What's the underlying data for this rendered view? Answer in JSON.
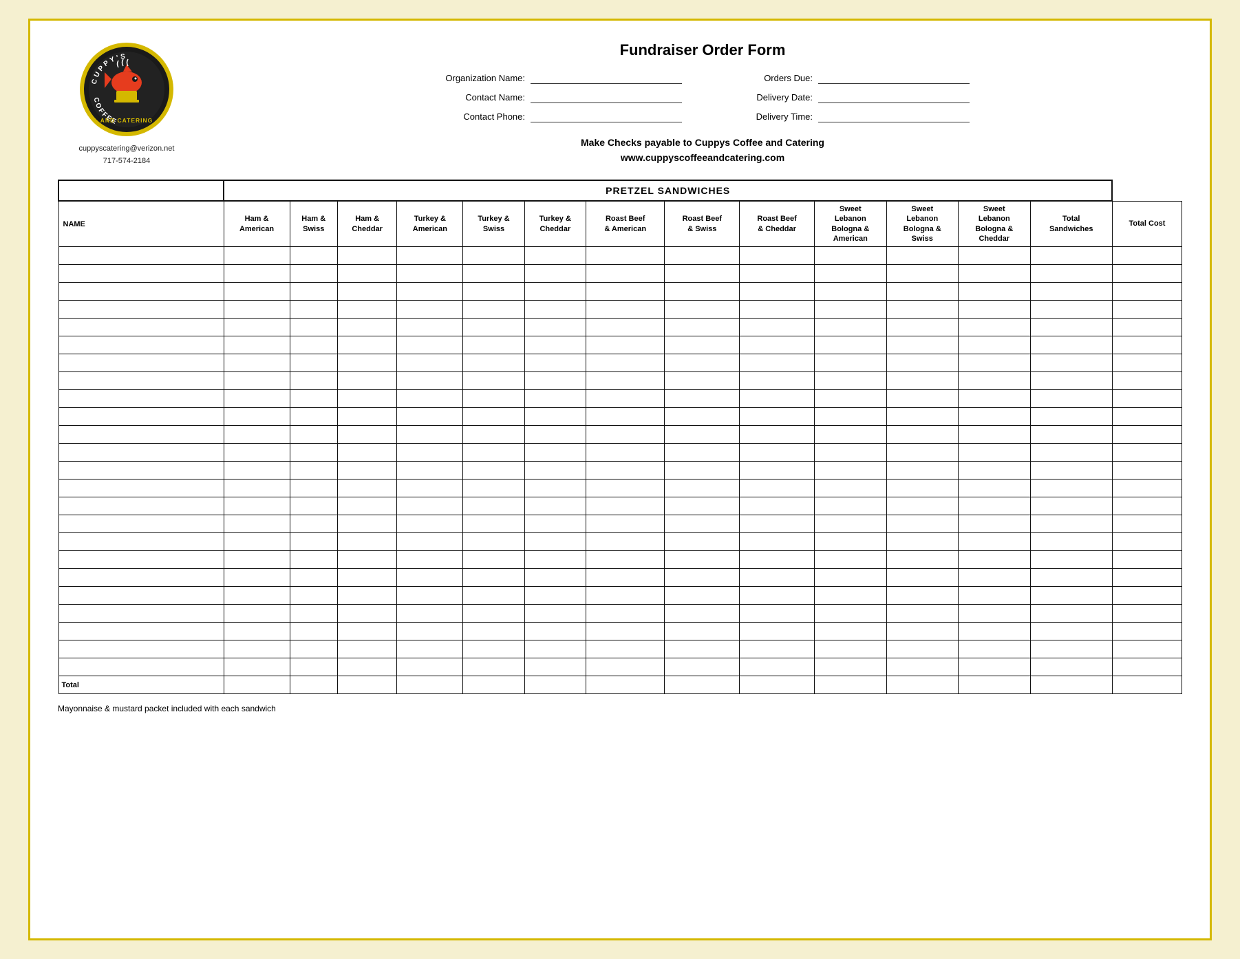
{
  "page": {
    "title": "Fundraiser Order Form"
  },
  "logo": {
    "email": "cuppyscatering@verizon.net",
    "phone": "717-574-2184"
  },
  "form": {
    "fields": {
      "org_name_label": "Organization Name:",
      "contact_name_label": "Contact Name:",
      "contact_phone_label": "Contact Phone:",
      "orders_due_label": "Orders Due:",
      "delivery_date_label": "Delivery Date:",
      "delivery_time_label": "Delivery Time:"
    },
    "checks_line1": "Make Checks payable to Cuppys Coffee and Catering",
    "checks_line2": "www.cuppyscoffeeandcatering.com"
  },
  "table": {
    "section_title": "PRETZEL SANDWICHES",
    "columns": [
      "NAME",
      "Ham & American",
      "Ham & Swiss",
      "Ham & Cheddar",
      "Turkey & American",
      "Turkey & Swiss",
      "Turkey & Cheddar",
      "Roast Beef & American",
      "Roast Beef & Swiss",
      "Roast Beef & Cheddar",
      "Sweet Lebanon Bologna & American",
      "Sweet Lebanon Bologna & Swiss",
      "Sweet Lebanon Bologna & Cheddar",
      "Total Sandwiches",
      "Total Cost"
    ],
    "data_rows": 24,
    "total_row_label": "Total"
  },
  "footer": {
    "note": "Mayonnaise & mustard packet included with each sandwich"
  }
}
